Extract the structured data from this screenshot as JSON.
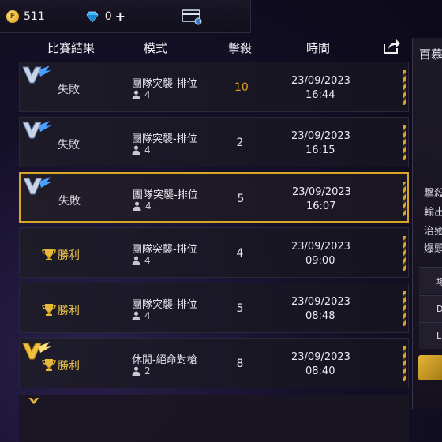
{
  "topbar": {
    "coin_symbol": "F",
    "coins": "511",
    "diamonds": "0",
    "plus": "+",
    "icon_names": [
      "gold-coin-icon",
      "diamond-icon",
      "card-icon"
    ]
  },
  "header": {
    "result": "比賽結果",
    "mode": "模式",
    "kills": "擊殺",
    "time": "時間",
    "share_icon": "share-icon"
  },
  "matches": [
    {
      "result": "失敗",
      "outcome": "lose",
      "mode": "團隊突襲-排位",
      "players": "4",
      "kills": "10",
      "date": "23/09/2023",
      "time": "16:44"
    },
    {
      "result": "失敗",
      "outcome": "lose",
      "mode": "團隊突襲-排位",
      "players": "4",
      "kills": "2",
      "date": "23/09/2023",
      "time": "16:15"
    },
    {
      "result": "失敗",
      "outcome": "lose",
      "mode": "團隊突襲-排位",
      "players": "4",
      "kills": "5",
      "date": "23/09/2023",
      "time": "16:07",
      "selected": true
    },
    {
      "result": "勝利",
      "outcome": "win",
      "mode": "團隊突襲-排位",
      "players": "4",
      "kills": "4",
      "date": "23/09/2023",
      "time": "09:00"
    },
    {
      "result": "勝利",
      "outcome": "win",
      "mode": "團隊突襲-排位",
      "players": "4",
      "kills": "5",
      "date": "23/09/2023",
      "time": "08:48"
    },
    {
      "result": "勝利",
      "outcome": "win",
      "mode": "休閒-絕命對槍",
      "players": "2",
      "kills": "8",
      "date": "23/09/2023",
      "time": "08:40"
    }
  ],
  "side_panel": {
    "title": "百慕",
    "stats": [
      "擊殺",
      "輸出",
      "治癒",
      "爆頭"
    ],
    "rows": [
      "場",
      "D",
      "L"
    ]
  },
  "colors": {
    "accent_gold": "#d8a623",
    "win": "#e8c24a",
    "lose": "#d8d6df",
    "background": "#15102a"
  }
}
